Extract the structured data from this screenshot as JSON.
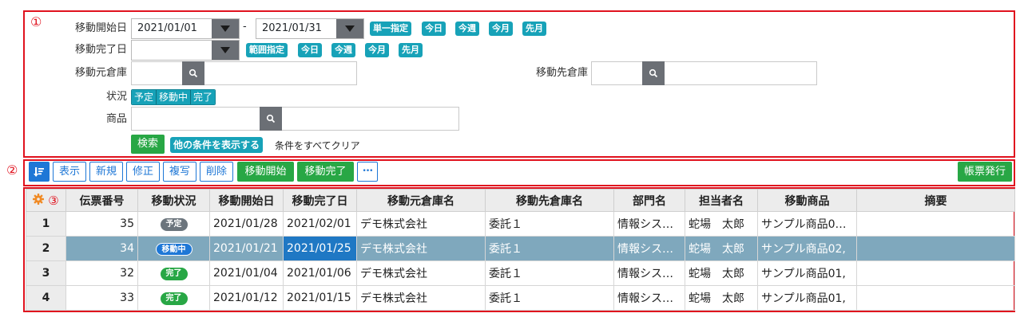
{
  "annotations": {
    "a1": "①",
    "a2": "②",
    "a3": "③"
  },
  "search": {
    "move_start_label": "移動開始日",
    "move_start_from": "2021/01/01",
    "range_sep": "-",
    "move_start_to": "2021/01/31",
    "start_chips": [
      "単一指定",
      "今日",
      "今週",
      "今月",
      "先月"
    ],
    "move_end_label": "移動完了日",
    "move_end_value": "",
    "end_chips": [
      "範囲指定",
      "今日",
      "今週",
      "今月",
      "先月"
    ],
    "source_wh_label": "移動元倉庫",
    "dest_wh_label": "移動先倉庫",
    "status_label": "状況",
    "status_options": [
      "予定",
      "移動中",
      "完了"
    ],
    "product_label": "商品",
    "search_button": "検索",
    "more_conditions": "他の条件を表示する",
    "clear_all": "条件をすべてクリア"
  },
  "toolbar": {
    "sort_icon": "sort-icon",
    "view": "表示",
    "new": "新規",
    "edit": "修正",
    "copy": "複写",
    "delete": "削除",
    "start_move": "移動開始",
    "complete_move": "移動完了",
    "more": "•••",
    "print": "帳票発行"
  },
  "table": {
    "settings_icon": "gear-icon",
    "columns": [
      "伝票番号",
      "移動状況",
      "移動開始日",
      "移動完了日",
      "移動元倉庫名",
      "移動先倉庫名",
      "部門名",
      "担当者名",
      "移動商品",
      "摘要"
    ],
    "rows": [
      {
        "row_no": "1",
        "slip_no": "35",
        "status": "予定",
        "start": "2021/01/28",
        "end": "2021/02/01",
        "source": "デモ株式会社",
        "dest": "委託１",
        "dept": "情報シス…",
        "person": "蛇場　太郎",
        "product": "サンプル商品0…",
        "note": ""
      },
      {
        "row_no": "2",
        "slip_no": "34",
        "status": "移動中",
        "start": "2021/01/21",
        "end": "2021/01/25",
        "source": "デモ株式会社",
        "dest": "委託１",
        "dept": "情報シス…",
        "person": "蛇場　太郎",
        "product": "サンプル商品02,",
        "note": ""
      },
      {
        "row_no": "3",
        "slip_no": "32",
        "status": "完了",
        "start": "2021/01/04",
        "end": "2021/01/06",
        "source": "デモ株式会社",
        "dest": "委託１",
        "dept": "情報シス…",
        "person": "蛇場　太郎",
        "product": "サンプル商品01,",
        "note": ""
      },
      {
        "row_no": "4",
        "slip_no": "33",
        "status": "完了",
        "start": "2021/01/12",
        "end": "2021/01/15",
        "source": "デモ株式会社",
        "dest": "委託１",
        "dept": "情報シス…",
        "person": "蛇場　太郎",
        "product": "サンプル商品01,",
        "note": ""
      }
    ],
    "selected_row": 2
  },
  "colors": {
    "annotation_red": "#e0121e",
    "chip_teal": "#17a2b8",
    "green": "#28a745",
    "primary_blue": "#1e77d6",
    "selected_row": "#7fa8bd",
    "active_cell": "#1f78c4",
    "status_planned": "#6c757d",
    "status_moving": "#1e77d6",
    "status_done": "#28a745"
  }
}
